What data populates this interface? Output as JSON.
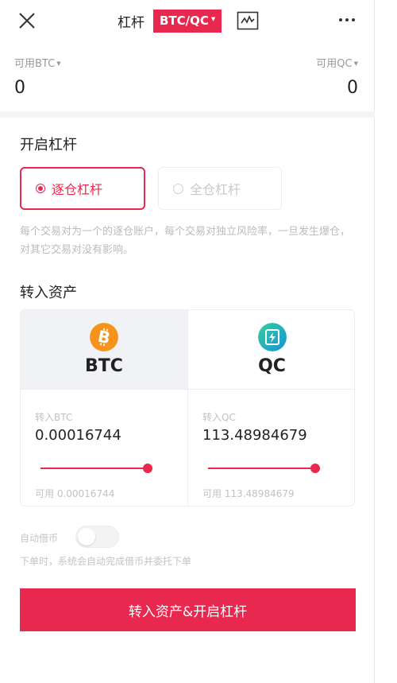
{
  "header": {
    "title": "杠杆",
    "pair": "BTC/QC",
    "icons": [
      "close-icon",
      "kline-chart-icon",
      "more-icon"
    ]
  },
  "balances": {
    "left_label": "可用BTC",
    "left_value": "0",
    "right_label": "可用QC",
    "right_value": "0"
  },
  "leverage": {
    "title": "开启杠杆",
    "isolated_label": "逐仓杠杆",
    "cross_label": "全仓杠杆",
    "selected": "isolated",
    "description": "每个交易对为一个的逐仓账户，每个交易对独立风险率，一旦发生爆仓，对其它交易对没有影响。"
  },
  "transfer": {
    "title": "转入资产",
    "btc": {
      "coin": "BTC",
      "input_label": "转入BTC",
      "amount": "0.00016744",
      "available": "可用 0.00016744",
      "slider_fraction": 1.0
    },
    "qc": {
      "coin": "QC",
      "input_label": "转入QC",
      "amount": "113.48984679",
      "available": "可用 113.48984679",
      "slider_fraction": 1.0
    }
  },
  "auto_borrow": {
    "label": "自动借币",
    "enabled": false,
    "description": "下单时，系统会自动完成借币并委托下单"
  },
  "submit_label": "转入资产&开启杠杆",
  "colors": {
    "accent": "#e8284e",
    "btc": "#f7931a",
    "qc": "#22b8a5"
  }
}
